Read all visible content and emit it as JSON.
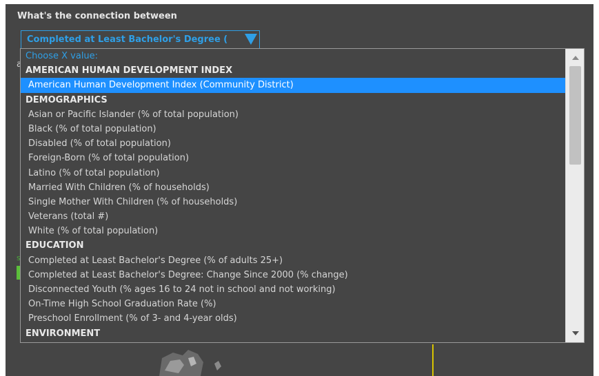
{
  "question": "What's the connection between",
  "selector": {
    "selected_value": "Completed at Least Bachelor's Degree ("
  },
  "background": {
    "partial_a": "a",
    "partial_s": "s"
  },
  "dropdown": {
    "options": [
      {
        "label": "Choose X value:",
        "kind": "placeholder",
        "selected": false
      },
      {
        "label": "AMERICAN HUMAN DEVELOPMENT INDEX",
        "kind": "group",
        "selected": false
      },
      {
        "label": "American Human Development Index (Community District)",
        "kind": "option",
        "selected": true
      },
      {
        "label": "DEMOGRAPHICS",
        "kind": "group",
        "selected": false
      },
      {
        "label": "Asian or Pacific Islander (% of total population)",
        "kind": "option",
        "selected": false
      },
      {
        "label": "Black (% of total population)",
        "kind": "option",
        "selected": false
      },
      {
        "label": "Disabled (% of total population)",
        "kind": "option",
        "selected": false
      },
      {
        "label": "Foreign-Born (% of total population)",
        "kind": "option",
        "selected": false
      },
      {
        "label": "Latino (% of total population)",
        "kind": "option",
        "selected": false
      },
      {
        "label": "Married With Children (% of households)",
        "kind": "option",
        "selected": false
      },
      {
        "label": "Single Mother With Children (% of households)",
        "kind": "option",
        "selected": false
      },
      {
        "label": "Veterans (total #)",
        "kind": "option",
        "selected": false
      },
      {
        "label": "White (% of total population)",
        "kind": "option",
        "selected": false
      },
      {
        "label": "EDUCATION",
        "kind": "group",
        "selected": false
      },
      {
        "label": "Completed at Least Bachelor's Degree (% of adults 25+)",
        "kind": "option",
        "selected": false
      },
      {
        "label": "Completed at Least Bachelor's Degree: Change Since 2000 (% change)",
        "kind": "option",
        "selected": false
      },
      {
        "label": "Disconnected Youth (% ages 16 to 24 not in school and not working)",
        "kind": "option",
        "selected": false
      },
      {
        "label": "On-Time High School Graduation Rate (%)",
        "kind": "option",
        "selected": false
      },
      {
        "label": "Preschool Enrollment (% of 3- and 4-year olds)",
        "kind": "option",
        "selected": false
      },
      {
        "label": "ENVIRONMENT",
        "kind": "group",
        "selected": false
      }
    ]
  },
  "icons": {
    "select_arrow": "triangle-down-icon",
    "scroll_up": "scroll-up-arrow-icon",
    "scroll_down": "scroll-down-arrow-icon"
  },
  "colors": {
    "accent": "#2f9fe6",
    "selected_bg": "#1e90ff",
    "panel_bg": "#454545"
  }
}
